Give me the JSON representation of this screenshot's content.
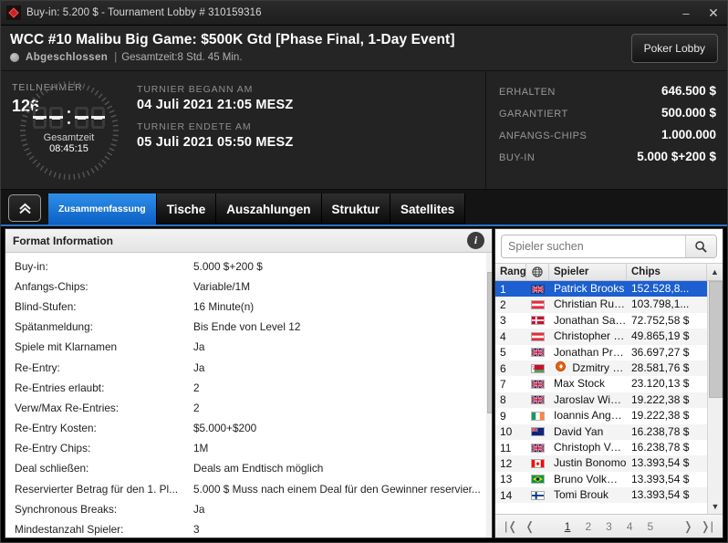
{
  "titlebar": {
    "title": "Buy-in: 5.200 $ - Tournament Lobby # 310159316",
    "minimize": "–",
    "close": "✕",
    "app_icon": "diamond-icon"
  },
  "header": {
    "title": "WCC #10 Malibu Big Game: $500K Gtd [Phase Final, 1-Day Event]",
    "status": "Abgeschlossen",
    "separator": "|",
    "total_time": "Gesamtzeit:8 Std.  45 Min.",
    "lobby_button": "Poker Lobby"
  },
  "info_band": {
    "participants_label": "Teilnehmer",
    "participants_value": "126",
    "clock": {
      "display": "--:--",
      "label": "Gesamtzeit",
      "value": "08:45:15"
    },
    "start_label": "Turnier begann am",
    "start_value": "04 Juli 2021  21:05 MESZ",
    "end_label": "Turnier endete am",
    "end_value": "05 Juli 2021  05:50 MESZ",
    "prize_rows": [
      {
        "label": "Erhalten",
        "value": "646.500 $"
      },
      {
        "label": "Garantiert",
        "value": "500.000 $"
      },
      {
        "label": "Anfangs-Chips",
        "value": "1.000.000"
      },
      {
        "label": "Buy-in",
        "value": "5.000 $+200 $"
      }
    ]
  },
  "tabs": {
    "collapse_label": "⌃",
    "items": [
      {
        "label": "Zusammenfassung",
        "active": true
      },
      {
        "label": "Tische",
        "active": false
      },
      {
        "label": "Auszahlungen",
        "active": false
      },
      {
        "label": "Struktur",
        "active": false
      },
      {
        "label": "Satellites",
        "active": false
      }
    ]
  },
  "format_panel": {
    "title": "Format Information",
    "info_icon": "i",
    "rows": [
      {
        "key": "Buy-in:",
        "value": "5.000 $+200 $"
      },
      {
        "key": "Anfangs-Chips:",
        "value": "Variable/1M"
      },
      {
        "key": "Blind-Stufen:",
        "value": "16 Minute(n)"
      },
      {
        "key": "Spätanmeldung:",
        "value": "Bis Ende von Level 12"
      },
      {
        "key": "Spiele mit Klarnamen",
        "value": "Ja"
      },
      {
        "key": "Re-Entry:",
        "value": "Ja"
      },
      {
        "key": "Re-Entries erlaubt:",
        "value": "2"
      },
      {
        "key": "Verw/Max Re-Entries:",
        "value": "2"
      },
      {
        "key": "Re-Entry Kosten:",
        "value": "$5.000+$200"
      },
      {
        "key": "Re-Entry Chips:",
        "value": "1M"
      },
      {
        "key": "Deal schließen:",
        "value": "Deals am Endtisch möglich"
      },
      {
        "key": "Reservierter Betrag für den 1. Pl...",
        "value": "5.000 $ Muss nach einem Deal für den Gewinner reservier..."
      },
      {
        "key": "Synchronous Breaks:",
        "value": "Ja"
      },
      {
        "key": "Mindestanzahl Spieler:",
        "value": "3"
      }
    ]
  },
  "players_panel": {
    "search_placeholder": "Spieler suchen",
    "search_value": "",
    "search_icon": "search-icon",
    "columns": {
      "rank": "Rang",
      "flag": "globe-icon",
      "name": "Spieler",
      "chips": "Chips"
    },
    "rows": [
      {
        "rank": "1",
        "name": "Patrick Brooks",
        "chips": "152.528,8...",
        "flag": "gb",
        "selected": true,
        "badge": false
      },
      {
        "rank": "2",
        "name": "Christian Rudolph",
        "chips": "103.798,1...",
        "flag": "at",
        "selected": false,
        "badge": false
      },
      {
        "rank": "3",
        "name": "Jonathan Saks Sk..",
        "chips": "72.752,58 $",
        "flag": "dk",
        "selected": false,
        "badge": false
      },
      {
        "rank": "4",
        "name": "Christopher Pütz",
        "chips": "49.865,19 $",
        "flag": "at",
        "selected": false,
        "badge": false
      },
      {
        "rank": "5",
        "name": "Jonathan Proudf...",
        "chips": "36.697,27 $",
        "flag": "gb",
        "selected": false,
        "badge": false
      },
      {
        "rank": "6",
        "name": "Dzmitry Urban...",
        "chips": "28.581,76 $",
        "flag": "by",
        "selected": false,
        "badge": true
      },
      {
        "rank": "7",
        "name": "Max Stock",
        "chips": "23.120,13 $",
        "flag": "gb",
        "selected": false,
        "badge": false
      },
      {
        "rank": "8",
        "name": "Jaroslav Wisura",
        "chips": "19.222,38 $",
        "flag": "gb",
        "selected": false,
        "badge": false
      },
      {
        "rank": "9",
        "name": "Ioannis Angelou ...",
        "chips": "19.222,38 $",
        "flag": "ie",
        "selected": false,
        "badge": false
      },
      {
        "rank": "10",
        "name": "David Yan",
        "chips": "16.238,78 $",
        "flag": "nz",
        "selected": false,
        "badge": false
      },
      {
        "rank": "11",
        "name": "Christoph Vogels...",
        "chips": "16.238,78 $",
        "flag": "gb",
        "selected": false,
        "badge": false
      },
      {
        "rank": "12",
        "name": "Justin Bonomo",
        "chips": "13.393,54 $",
        "flag": "ca",
        "selected": false,
        "badge": false
      },
      {
        "rank": "13",
        "name": "Bruno Volkmann",
        "chips": "13.393,54 $",
        "flag": "br",
        "selected": false,
        "badge": false
      },
      {
        "rank": "14",
        "name": "Tomi Brouk",
        "chips": "13.393,54 $",
        "flag": "fi",
        "selected": false,
        "badge": false
      }
    ],
    "pager": {
      "first": "|❬",
      "prev": "❬",
      "next": "❭",
      "last": "❭|",
      "pages": [
        "1",
        "2",
        "3",
        "4",
        "5"
      ],
      "current": "1"
    }
  },
  "colors": {
    "accent_blue": "#1b5fd0",
    "tab_active": "#0b5fc4",
    "window_bg": "#232323",
    "status_gray": "#9a9a9a"
  }
}
